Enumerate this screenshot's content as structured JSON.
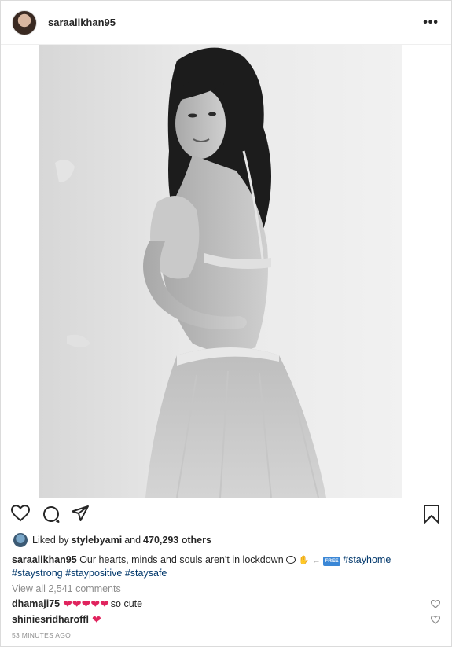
{
  "header": {
    "username": "saraalikhan95",
    "more_label": "•••"
  },
  "actions": {
    "like_icon": "heart-outline-icon",
    "comment_icon": "comment-icon",
    "share_icon": "share-icon",
    "save_icon": "bookmark-icon"
  },
  "likes": {
    "prefix": "Liked by",
    "liker": "stylebyami",
    "conjunction": "and",
    "others": "470,293 others"
  },
  "caption": {
    "username": "saraalikhan95",
    "text": "Our hearts, minds and souls aren't in lockdown",
    "emoji_badge": "FREE",
    "hashtags_line1": [
      "#stayhome"
    ],
    "hashtags_line2": [
      "#staystrong",
      "#staypositive",
      "#staysafe"
    ]
  },
  "view_comments": "View all 2,541 comments",
  "comments": [
    {
      "username": "dhamaji75",
      "hearts": "❤❤❤❤❤",
      "text": "so cute"
    },
    {
      "username": "shiniesridharoffl",
      "hearts": "❤",
      "text": ""
    }
  ],
  "timestamp": "53 MINUTES AGO",
  "colors": {
    "hashtag": "#00376b",
    "heart": "#e0245e",
    "muted": "#8e8e8e"
  }
}
